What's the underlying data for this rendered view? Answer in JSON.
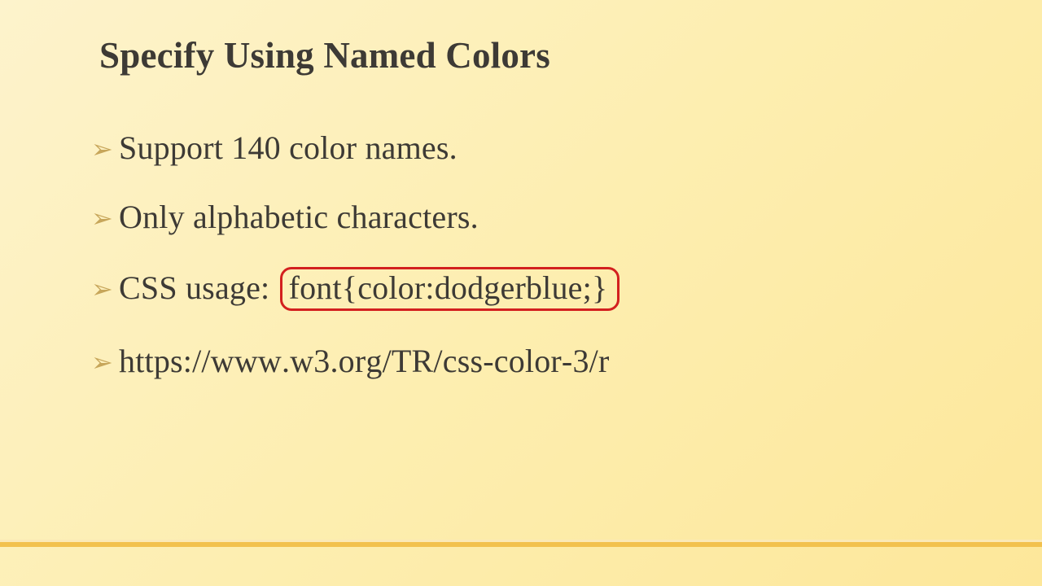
{
  "title": "Specify Using Named Colors",
  "bullets": {
    "b0": "Support 140 color names.",
    "b1": "Only alphabetic characters.",
    "b2_prefix": "CSS usage: ",
    "b2_boxed": "font{color:dodgerblue;}",
    "b3": "https://www.w3.org/TR/css-color-3/r"
  },
  "glyphs": {
    "chevron": "➢"
  }
}
